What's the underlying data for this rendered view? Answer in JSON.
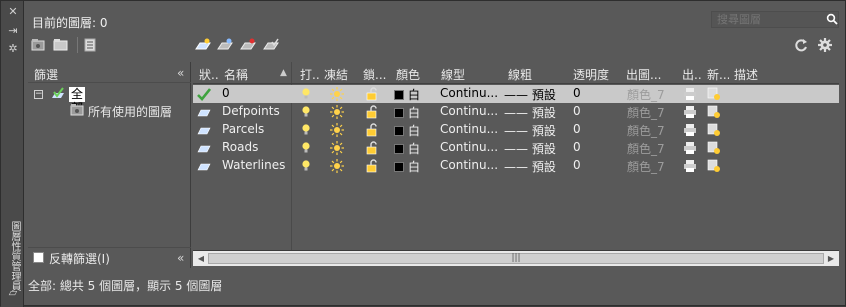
{
  "window": {
    "title": "目前的圖層: 0",
    "side_title": "圖層性質管理員"
  },
  "search": {
    "placeholder": "搜尋圖層"
  },
  "filters": {
    "title": "篩選",
    "tree_root": "全部",
    "tree_child": "所有使用的圖層",
    "invert_label": "反轉篩選(I)"
  },
  "columns": [
    "狀...",
    "名稱",
    "打...",
    "凍結",
    "鎖...",
    "顏色",
    "線型",
    "線粗",
    "透明度",
    "出圖...",
    "出...",
    "新...",
    "描述"
  ],
  "layers": [
    {
      "name": "0",
      "color": "白",
      "linetype": "Continu...",
      "lineweight": "—— 預設",
      "transparency": "0",
      "plotstyle": "顏色_7",
      "selected": true,
      "current": true
    },
    {
      "name": "Defpoints",
      "color": "白",
      "linetype": "Continu...",
      "lineweight": "—— 預設",
      "transparency": "0",
      "plotstyle": "顏色_7",
      "selected": false,
      "current": false
    },
    {
      "name": "Parcels",
      "color": "白",
      "linetype": "Continu...",
      "lineweight": "—— 預設",
      "transparency": "0",
      "plotstyle": "顏色_7",
      "selected": false,
      "current": false
    },
    {
      "name": "Roads",
      "color": "白",
      "linetype": "Continu...",
      "lineweight": "—— 預設",
      "transparency": "0",
      "plotstyle": "顏色_7",
      "selected": false,
      "current": false
    },
    {
      "name": "Waterlines",
      "color": "白",
      "linetype": "Continu...",
      "lineweight": "—— 預設",
      "transparency": "0",
      "plotstyle": "顏色_7",
      "selected": false,
      "current": false
    }
  ],
  "status": "全部: 總共 5 個圖層，顯示 5 個圖層",
  "scroll_thumb": "|||"
}
